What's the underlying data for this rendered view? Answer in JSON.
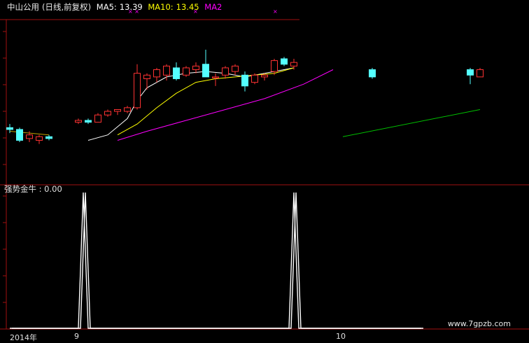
{
  "header": {
    "stock": "中山公用",
    "period": "(日线,前复权)",
    "ma5_label": "MA5:",
    "ma5_value": "13.39",
    "ma10_label": "MA10:",
    "ma10_value": "13.45",
    "ma20_label": "MA2",
    "colors": {
      "stock": "#e8e8e8",
      "ma5": "#ffffff",
      "ma10": "#ffff00",
      "ma20": "#ff00ff"
    }
  },
  "indicator": {
    "label": "强势金牛",
    "value": ": 0.00"
  },
  "watermark": "www.7gpzb.com",
  "x_axis": {
    "year_label": "2014年",
    "ticks": [
      "9",
      "10"
    ]
  },
  "theme": {
    "bg": "#000000",
    "frame": "#a01010",
    "up": "#ff3232",
    "down": "#54ffff",
    "signal": "#ffffff",
    "ma_extra": "#00c000"
  },
  "chart_data": [
    {
      "type": "candlestick",
      "title": "中山公用",
      "ylim": [
        8.0,
        16.5
      ],
      "candles": [
        {
          "i": 0,
          "o": 11.0,
          "h": 11.2,
          "l": 10.7,
          "c": 10.9
        },
        {
          "i": 1,
          "o": 10.9,
          "h": 11.0,
          "l": 10.2,
          "c": 10.3
        },
        {
          "i": 2,
          "o": 10.4,
          "h": 10.8,
          "l": 10.2,
          "c": 10.6
        },
        {
          "i": 3,
          "o": 10.3,
          "h": 10.6,
          "l": 10.1,
          "c": 10.5
        },
        {
          "i": 4,
          "o": 10.5,
          "h": 10.6,
          "l": 10.3,
          "c": 10.4
        },
        {
          "i": 7,
          "o": 11.3,
          "h": 11.5,
          "l": 11.2,
          "c": 11.4
        },
        {
          "i": 8,
          "o": 11.4,
          "h": 11.5,
          "l": 11.2,
          "c": 11.3
        },
        {
          "i": 9,
          "o": 11.3,
          "h": 11.8,
          "l": 11.3,
          "c": 11.7
        },
        {
          "i": 10,
          "o": 11.7,
          "h": 12.0,
          "l": 11.6,
          "c": 11.9
        },
        {
          "i": 11,
          "o": 11.9,
          "h": 12.0,
          "l": 11.7,
          "c": 12.0
        },
        {
          "i": 12,
          "o": 11.9,
          "h": 12.2,
          "l": 11.8,
          "c": 12.1
        },
        {
          "i": 13,
          "o": 12.1,
          "h": 14.5,
          "l": 12.0,
          "c": 14.0
        },
        {
          "i": 14,
          "o": 13.7,
          "h": 14.0,
          "l": 13.1,
          "c": 13.9
        },
        {
          "i": 15,
          "o": 13.8,
          "h": 14.3,
          "l": 13.5,
          "c": 14.2
        },
        {
          "i": 16,
          "o": 13.9,
          "h": 14.5,
          "l": 13.6,
          "c": 14.4
        },
        {
          "i": 17,
          "o": 14.3,
          "h": 14.6,
          "l": 13.6,
          "c": 13.7
        },
        {
          "i": 18,
          "o": 13.9,
          "h": 14.4,
          "l": 13.8,
          "c": 14.3
        },
        {
          "i": 19,
          "o": 14.2,
          "h": 14.6,
          "l": 14.0,
          "c": 14.4
        },
        {
          "i": 20,
          "o": 14.5,
          "h": 15.3,
          "l": 13.9,
          "c": 13.8
        },
        {
          "i": 21,
          "o": 13.8,
          "h": 14.0,
          "l": 13.3,
          "c": 13.8
        },
        {
          "i": 22,
          "o": 13.9,
          "h": 14.4,
          "l": 13.7,
          "c": 14.3
        },
        {
          "i": 23,
          "o": 14.1,
          "h": 14.5,
          "l": 13.9,
          "c": 14.4
        },
        {
          "i": 24,
          "o": 13.9,
          "h": 14.1,
          "l": 13.0,
          "c": 13.3
        },
        {
          "i": 25,
          "o": 13.5,
          "h": 14.0,
          "l": 13.4,
          "c": 13.9
        },
        {
          "i": 26,
          "o": 13.8,
          "h": 14.0,
          "l": 13.6,
          "c": 13.9
        },
        {
          "i": 27,
          "o": 14.1,
          "h": 14.8,
          "l": 13.9,
          "c": 14.7
        },
        {
          "i": 28,
          "o": 14.8,
          "h": 14.9,
          "l": 14.4,
          "c": 14.5
        },
        {
          "i": 29,
          "o": 14.4,
          "h": 14.8,
          "l": 14.2,
          "c": 14.6
        },
        {
          "i": 37,
          "o": 14.2,
          "h": 14.3,
          "l": 13.7,
          "c": 13.8
        },
        {
          "i": 47,
          "o": 14.2,
          "h": 14.3,
          "l": 13.4,
          "c": 13.9
        },
        {
          "i": 48,
          "o": 13.8,
          "h": 14.3,
          "l": 13.8,
          "c": 14.2
        }
      ],
      "ma_lines": [
        {
          "name": "MA5",
          "color": "#ffffff",
          "points": [
            [
              8,
              10.3
            ],
            [
              10,
              10.6
            ],
            [
              12,
              11.5
            ],
            [
              13,
              12.5
            ],
            [
              14,
              13.2
            ],
            [
              16,
              13.8
            ],
            [
              18,
              14.0
            ],
            [
              20,
              14.1
            ],
            [
              22,
              14.0
            ],
            [
              24,
              13.8
            ],
            [
              26,
              14.0
            ],
            [
              28,
              14.2
            ],
            [
              29,
              14.3
            ]
          ]
        },
        {
          "name": "MA10",
          "color": "#ffff00",
          "points": [
            [
              11,
              10.6
            ],
            [
              13,
              11.2
            ],
            [
              15,
              12.1
            ],
            [
              17,
              12.9
            ],
            [
              19,
              13.5
            ],
            [
              21,
              13.7
            ],
            [
              23,
              13.8
            ],
            [
              25,
              13.9
            ],
            [
              27,
              14.0
            ],
            [
              29,
              14.3
            ]
          ]
        },
        {
          "name": "MA20",
          "color": "#ff00ff",
          "points": [
            [
              11,
              10.3
            ],
            [
              14,
              10.8
            ],
            [
              18,
              11.4
            ],
            [
              22,
              12.0
            ],
            [
              26,
              12.6
            ],
            [
              30,
              13.4
            ],
            [
              33,
              14.2
            ]
          ]
        },
        {
          "name": "",
          "color": "#00c000",
          "points": [
            [
              34,
              10.5
            ],
            [
              48,
              12.0
            ]
          ]
        },
        {
          "name": "",
          "color": "#c0a000",
          "points": [
            [
              0,
              10.8
            ],
            [
              4,
              10.6
            ]
          ]
        }
      ]
    },
    {
      "type": "line",
      "title": "强势金牛",
      "ylim": [
        0,
        1
      ],
      "x": [
        0,
        6,
        7,
        7.5,
        8,
        9,
        28,
        28.5,
        29,
        29.5,
        30,
        42
      ],
      "values": [
        0,
        0,
        0,
        1,
        0,
        0,
        0,
        0,
        1,
        0,
        0,
        0
      ]
    }
  ]
}
